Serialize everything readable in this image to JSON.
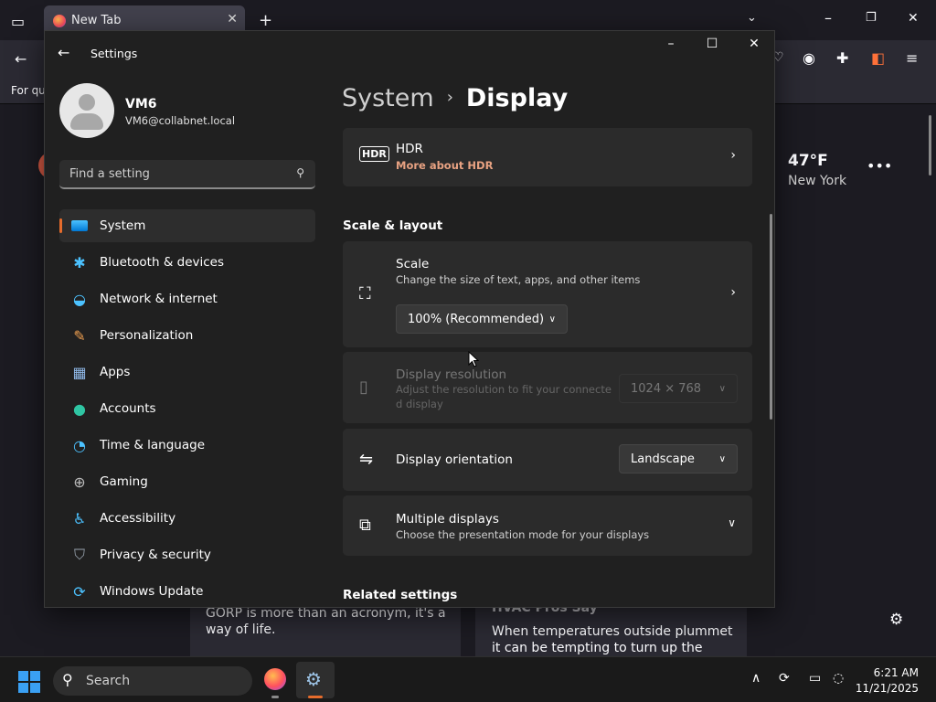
{
  "browser": {
    "tab_title": "New Tab",
    "bookmarks_text": "For qu",
    "weather": {
      "temp": "47°F",
      "city": "New York"
    },
    "news": [
      {
        "text": "GORP is more than an acronym, it's a way of life."
      },
      {
        "title": "HVAC Pros Say",
        "text": "When temperatures outside plummet it can be tempting to turn up the heat, but"
      }
    ]
  },
  "settings": {
    "app_title": "Settings",
    "user": {
      "name": "VM6",
      "email": "VM6@collabnet.local"
    },
    "search": {
      "placeholder": "Find a setting"
    },
    "nav": [
      {
        "label": "System",
        "icon": "system-icon",
        "active": true
      },
      {
        "label": "Bluetooth & devices",
        "icon": "bluetooth-icon"
      },
      {
        "label": "Network & internet",
        "icon": "wifi-icon"
      },
      {
        "label": "Personalization",
        "icon": "brush-icon"
      },
      {
        "label": "Apps",
        "icon": "apps-icon"
      },
      {
        "label": "Accounts",
        "icon": "account-icon"
      },
      {
        "label": "Time & language",
        "icon": "globe-clock-icon"
      },
      {
        "label": "Gaming",
        "icon": "gamepad-icon"
      },
      {
        "label": "Accessibility",
        "icon": "accessibility-icon"
      },
      {
        "label": "Privacy & security",
        "icon": "shield-icon"
      },
      {
        "label": "Windows Update",
        "icon": "update-icon"
      }
    ],
    "breadcrumb": {
      "parent": "System",
      "separator": "›",
      "current": "Display"
    },
    "hdr": {
      "title": "HDR",
      "link": "More about HDR"
    },
    "scale_layout_heading": "Scale & layout",
    "scale": {
      "title": "Scale",
      "sub": "Change the size of text, apps, and other items",
      "value": "100% (Recommended)"
    },
    "resolution": {
      "title": "Display resolution",
      "sub_line1": "Adjust the resolution to fit your connecte",
      "sub_line2": "d display",
      "value": "1024 × 768"
    },
    "orientation": {
      "title": "Display orientation",
      "value": "Landscape"
    },
    "multiple": {
      "title": "Multiple displays",
      "sub": "Choose the presentation mode for your displays"
    },
    "related_heading": "Related settings"
  },
  "taskbar": {
    "search_label": "Search",
    "time": "6:21 AM",
    "date": "11/21/2025"
  },
  "colors": {
    "accent": "#e66c2c",
    "link": "#e8a282",
    "window_bg": "#202020",
    "card_bg": "#2b2b2b"
  }
}
